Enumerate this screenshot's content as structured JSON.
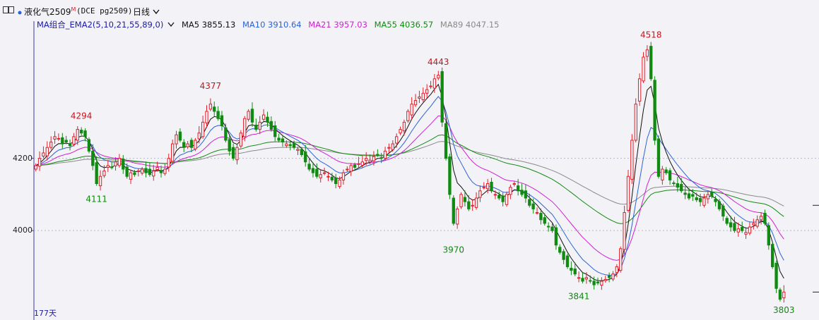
{
  "toolbar": {
    "symbol_name": "液化气2509",
    "symbol_sup": "M",
    "code": "(DCE pg2509)",
    "period": "日线"
  },
  "indicator": {
    "name": "MA组合_EMA2(5,10,21,55,89,0)",
    "items": [
      {
        "label": "MA5 3855.13",
        "color": "#111111"
      },
      {
        "label": "MA10 3910.64",
        "color": "#2b62d6"
      },
      {
        "label": "MA21 3957.03",
        "color": "#d020d0"
      },
      {
        "label": "MA55 4036.57",
        "color": "#148a14"
      },
      {
        "label": "MA89 4047.15",
        "color": "#8a8a8a"
      }
    ]
  },
  "footer": {
    "days_label": "177天"
  },
  "colors": {
    "up": "#e0202a",
    "down": "#118a11",
    "background": "#f3f3f7"
  },
  "chart_data": {
    "type": "candlestick",
    "ylim": [
      3780,
      4560
    ],
    "yticks": [
      4000,
      4200
    ],
    "annotations": [
      {
        "label": "4294",
        "index": 12,
        "value": 4294,
        "position": "above"
      },
      {
        "label": "4111",
        "index": 16,
        "value": 4111,
        "position": "below"
      },
      {
        "label": "4377",
        "index": 46,
        "value": 4377,
        "position": "above"
      },
      {
        "label": "4443",
        "index": 106,
        "value": 4443,
        "position": "above"
      },
      {
        "label": "3970",
        "index": 110,
        "value": 3970,
        "position": "below"
      },
      {
        "label": "3841",
        "index": 143,
        "value": 3841,
        "position": "below"
      },
      {
        "label": "4518",
        "index": 162,
        "value": 4518,
        "position": "above"
      },
      {
        "label": "3803",
        "index": 197,
        "value": 3803,
        "position": "below"
      }
    ],
    "closes": [
      4180,
      4200,
      4215,
      4230,
      4245,
      4260,
      4255,
      4240,
      4245,
      4235,
      4260,
      4280,
      4270,
      4260,
      4220,
      4180,
      4130,
      4150,
      4165,
      4180,
      4175,
      4190,
      4200,
      4170,
      4150,
      4160,
      4155,
      4165,
      4170,
      4160,
      4155,
      4165,
      4175,
      4160,
      4170,
      4200,
      4240,
      4265,
      4250,
      4230,
      4240,
      4230,
      4250,
      4270,
      4300,
      4330,
      4350,
      4330,
      4310,
      4290,
      4250,
      4220,
      4200,
      4230,
      4270,
      4310,
      4330,
      4300,
      4280,
      4300,
      4320,
      4300,
      4280,
      4260,
      4250,
      4245,
      4240,
      4235,
      4230,
      4225,
      4210,
      4190,
      4170,
      4160,
      4150,
      4155,
      4160,
      4150,
      4140,
      4130,
      4140,
      4160,
      4170,
      4180,
      4175,
      4185,
      4190,
      4200,
      4195,
      4205,
      4210,
      4200,
      4220,
      4230,
      4240,
      4260,
      4280,
      4300,
      4330,
      4350,
      4360,
      4370,
      4380,
      4390,
      4400,
      4420,
      4430,
      4300,
      4200,
      4100,
      4020,
      4060,
      4100,
      4080,
      4060,
      4070,
      4090,
      4110,
      4120,
      4130,
      4110,
      4100,
      4090,
      4080,
      4100,
      4120,
      4130,
      4110,
      4100,
      4090,
      4070,
      4060,
      4050,
      4030,
      4020,
      4010,
      4000,
      3960,
      3940,
      3920,
      3900,
      3890,
      3880,
      3870,
      3860,
      3870,
      3860,
      3850,
      3855,
      3860,
      3865,
      3870,
      3880,
      3900,
      3950,
      4050,
      4150,
      4250,
      4350,
      4420,
      4480,
      4500,
      4420,
      4250,
      4150,
      4170,
      4160,
      4140,
      4130,
      4120,
      4110,
      4100,
      4090,
      4095,
      4085,
      4080,
      4090,
      4100,
      4095,
      4080,
      4060,
      4040,
      4020,
      4010,
      4000,
      4005,
      4000,
      3995,
      4010,
      4020,
      4030,
      4040,
      4020,
      3960,
      3900,
      3840,
      3810,
      3830
    ]
  }
}
